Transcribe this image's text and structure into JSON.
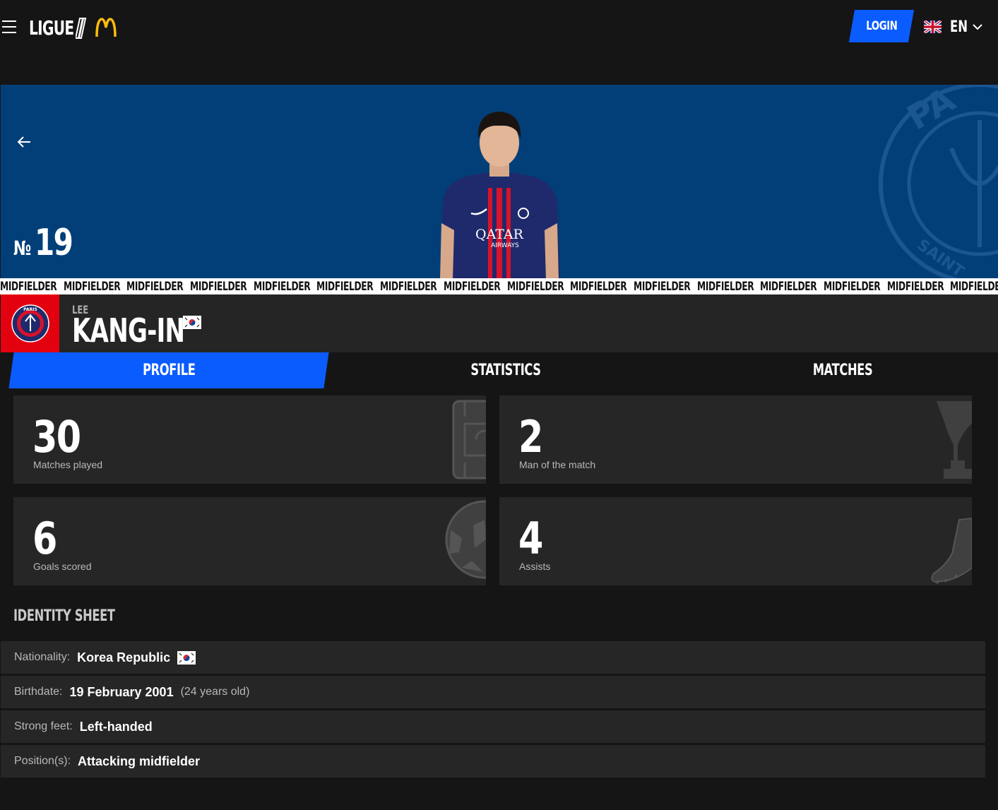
{
  "header": {
    "logo_text": "LIGUE",
    "logo_sponsor": "McDonald's",
    "login_label": "LOGIN",
    "language_code": "EN",
    "language_flag": "uk-flag-icon"
  },
  "hero": {
    "number_prefix": "№",
    "number": "19",
    "position_label": "MIDFIELDER",
    "background_color": "#023f78"
  },
  "player": {
    "first_name": "LEE",
    "last_name": "KANG-IN",
    "flag": "south-korea-flag-icon",
    "club_logo": "psg-crest-icon"
  },
  "tabs": [
    {
      "label": "PROFILE",
      "active": true
    },
    {
      "label": "STATISTICS",
      "active": false
    },
    {
      "label": "MATCHES",
      "active": false
    }
  ],
  "stats": [
    {
      "value": "30",
      "label": "Matches played",
      "icon": "pitch-icon"
    },
    {
      "value": "2",
      "label": "Man of the match",
      "icon": "trophy-icon"
    },
    {
      "value": "6",
      "label": "Goals scored",
      "icon": "ball-icon"
    },
    {
      "value": "4",
      "label": "Assists",
      "icon": "boot-icon"
    }
  ],
  "identity": {
    "title": "IDENTITY SHEET",
    "rows": [
      {
        "key": "Nationality:",
        "value": "Korea Republic",
        "extra": ""
      },
      {
        "key": "Birthdate:",
        "value": "19 February 2001",
        "extra": "(24 years old)"
      },
      {
        "key": "Strong feet:",
        "value": "Left-handed",
        "extra": ""
      },
      {
        "key": "Position(s):",
        "value": "Attacking midfielder",
        "extra": ""
      }
    ]
  },
  "colors": {
    "accent": "#0a5cff",
    "club_red": "#e3000f",
    "page_bg": "#151515",
    "card_bg": "#262626"
  }
}
